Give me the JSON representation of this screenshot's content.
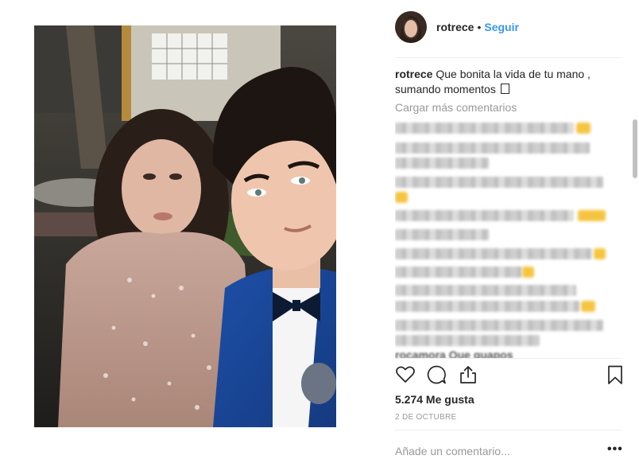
{
  "post": {
    "photo_alt": "",
    "username": "rotrece",
    "separator": "•",
    "follow_label": "Seguir"
  },
  "caption": {
    "username": "rotrece",
    "text": "Que bonita la vida de tu mano , sumando momentos"
  },
  "comments": {
    "load_more": "Cargar más comentarios",
    "clipped_text": "rocamora  Que guapos"
  },
  "actions": {
    "like_icon": "heart-icon",
    "comment_icon": "comment-icon",
    "share_icon": "share-icon",
    "save_icon": "bookmark-icon"
  },
  "stats": {
    "likes": "5.274 Me gusta",
    "date": "2 DE OCTUBRE"
  },
  "add_comment": {
    "placeholder": "Añade un comentario...",
    "more_label": "•••"
  },
  "colors": {
    "link": "#3897f0",
    "text": "#262626",
    "muted": "#999999"
  }
}
